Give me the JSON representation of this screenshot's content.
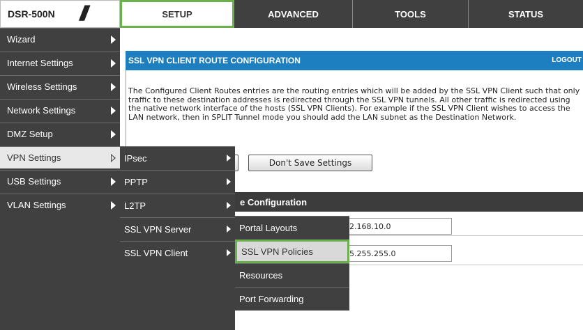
{
  "header": {
    "model": "DSR-500N",
    "tabs": [
      {
        "label": "SETUP"
      },
      {
        "label": "ADVANCED"
      },
      {
        "label": "TOOLS"
      },
      {
        "label": "STATUS"
      }
    ],
    "accent_color": "#6ab04c",
    "bar_color": "#404040"
  },
  "sidebar": {
    "items": [
      {
        "label": "Wizard"
      },
      {
        "label": "Internet Settings"
      },
      {
        "label": "Wireless Settings"
      },
      {
        "label": "Network Settings"
      },
      {
        "label": "DMZ Setup"
      },
      {
        "label": "VPN Settings"
      },
      {
        "label": "USB Settings"
      },
      {
        "label": "VLAN Settings"
      }
    ],
    "active": "VPN Settings"
  },
  "vpn_menu": {
    "items": [
      {
        "label": "IPsec"
      },
      {
        "label": "PPTP"
      },
      {
        "label": "L2TP"
      },
      {
        "label": "SSL VPN Server"
      },
      {
        "label": "SSL VPN Client"
      }
    ]
  },
  "ssl_client_menu": {
    "items": [
      {
        "label": "Portal Layouts"
      },
      {
        "label": "SSL VPN Policies"
      },
      {
        "label": "Resources"
      },
      {
        "label": "Port Forwarding"
      }
    ],
    "highlighted": "SSL VPN Policies"
  },
  "panel": {
    "title": "SSL VPN CLIENT ROUTE CONFIGURATION",
    "logout": "LOGOUT",
    "title_bg": "#1e7fc0",
    "description": "The Configured Client Routes entries are the routing entries which will be added by the SSL VPN Client such that only traffic to these destination addresses is redirected through the SSL VPN tunnels. All other traffic is redirected using the native network interface of the hosts (SSL VPN Clients). For example if the SSL VPN Client wishes to access the LAN network, then in SPLIT Tunnel mode you should add the LAN subnet as the Destination Network.",
    "dont_save_button": "Don't Save Settings",
    "section_title": "e Configuration",
    "destination_network_value": "2.168.10.0",
    "subnet_mask_value": "5.255.255.0"
  }
}
